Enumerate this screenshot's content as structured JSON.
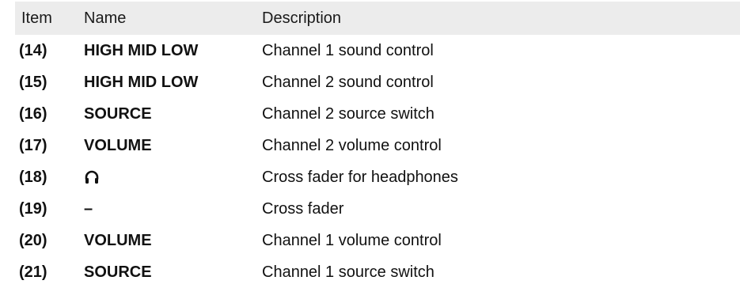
{
  "header": {
    "item": "Item",
    "name": "Name",
    "description": "Description"
  },
  "rows": [
    {
      "item": "(14)",
      "name": "HIGH MID LOW",
      "description": "Channel 1 sound control"
    },
    {
      "item": "(15)",
      "name": "HIGH MID LOW",
      "description": "Channel 2 sound control"
    },
    {
      "item": "(16)",
      "name": "SOURCE",
      "description": "Channel 2 source switch"
    },
    {
      "item": "(17)",
      "name": "VOLUME",
      "description": "Channel 2 volume control"
    },
    {
      "item": "(18)",
      "name_icon": "headphones-icon",
      "description": "Cross fader for headphones"
    },
    {
      "item": "(19)",
      "name": "–",
      "description": "Cross fader"
    },
    {
      "item": "(20)",
      "name": "VOLUME",
      "description": "Channel 1 volume control"
    },
    {
      "item": "(21)",
      "name": "SOURCE",
      "description": "Channel 1 source switch"
    }
  ],
  "colors": {
    "header_background": "#ececec",
    "text": "#111111"
  }
}
